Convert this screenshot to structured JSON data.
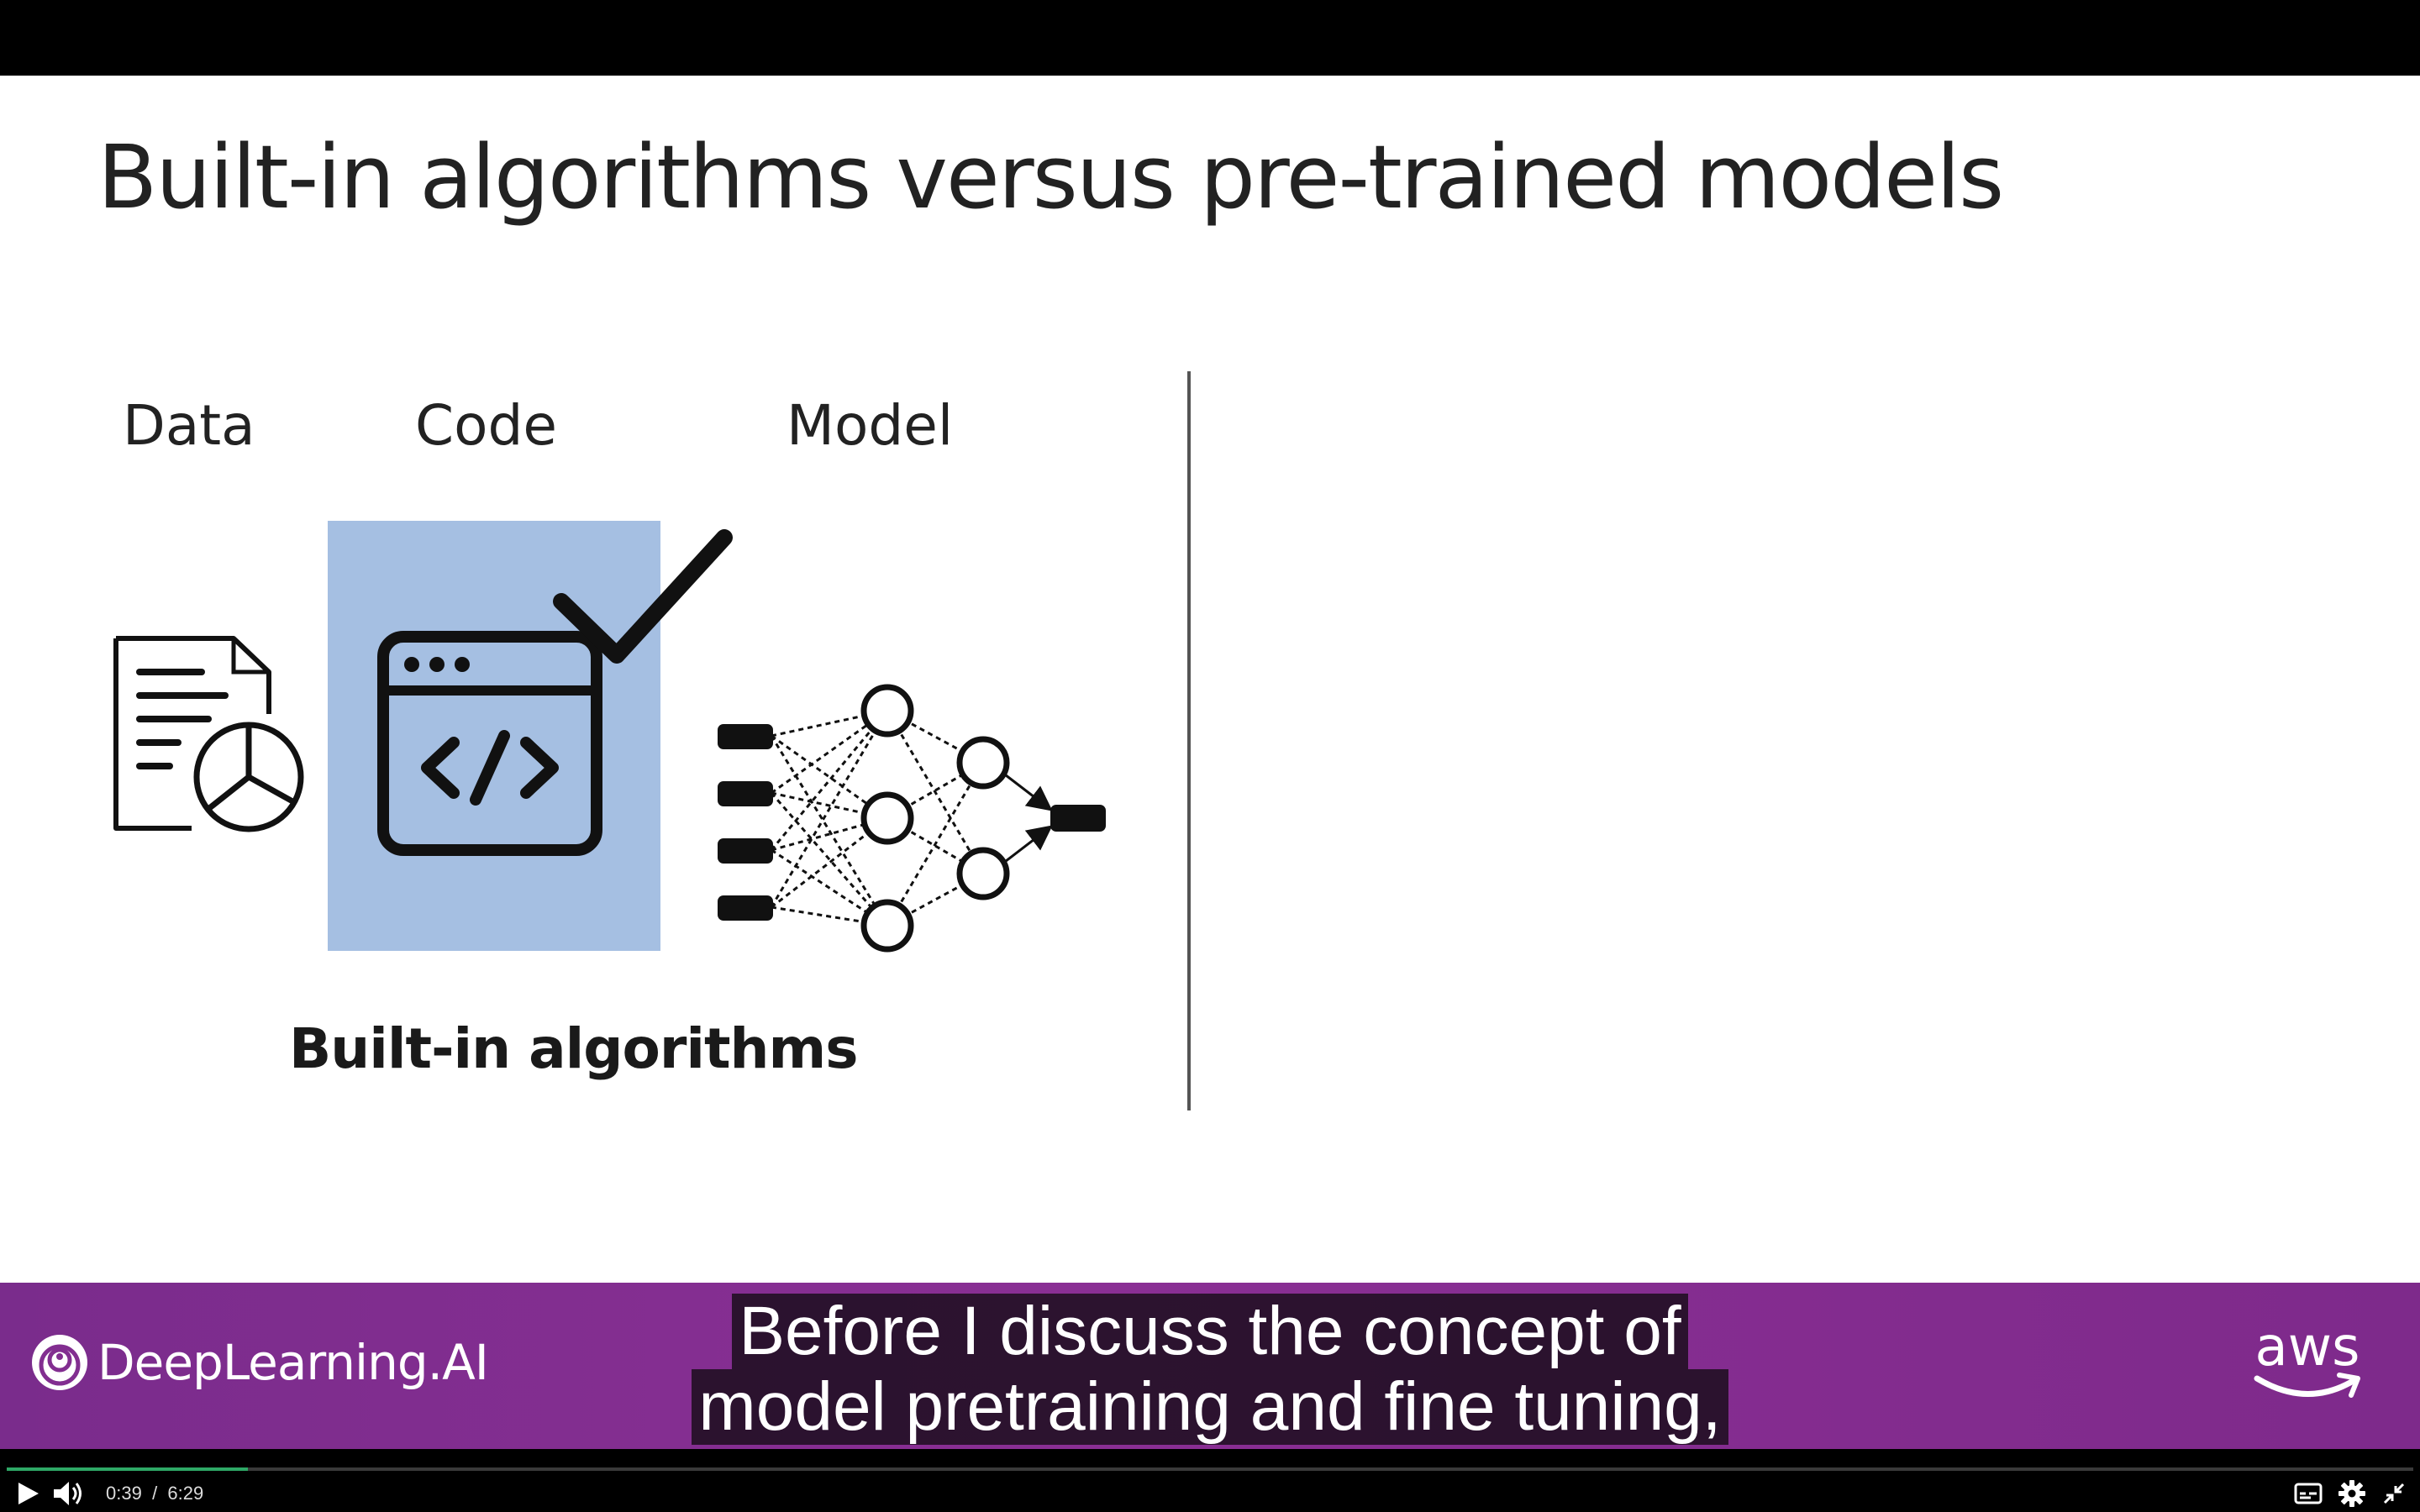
{
  "slide": {
    "title": "Built-in algorithms versus pre-trained models",
    "labels": {
      "data": "Data",
      "code": "Code",
      "model": "Model"
    },
    "section_label": "Built-in algorithms"
  },
  "banner": {
    "brand_name": "DeepLearning.AI",
    "partner_logo_text": "aws"
  },
  "captions": {
    "line1": "Before I discuss the concept of",
    "line2": "model pretraining and fine tuning,"
  },
  "player": {
    "current_time": "0:39",
    "separator": "/",
    "duration": "6:29",
    "progress": 0.1003,
    "accent_color": "#2ea866",
    "icons": [
      "play-icon",
      "volume-icon",
      "captions-icon",
      "gear-icon",
      "exit-fullscreen-icon"
    ]
  },
  "colors": {
    "banner_purple": "#822e90",
    "code_highlight": "#a5bfe2"
  }
}
